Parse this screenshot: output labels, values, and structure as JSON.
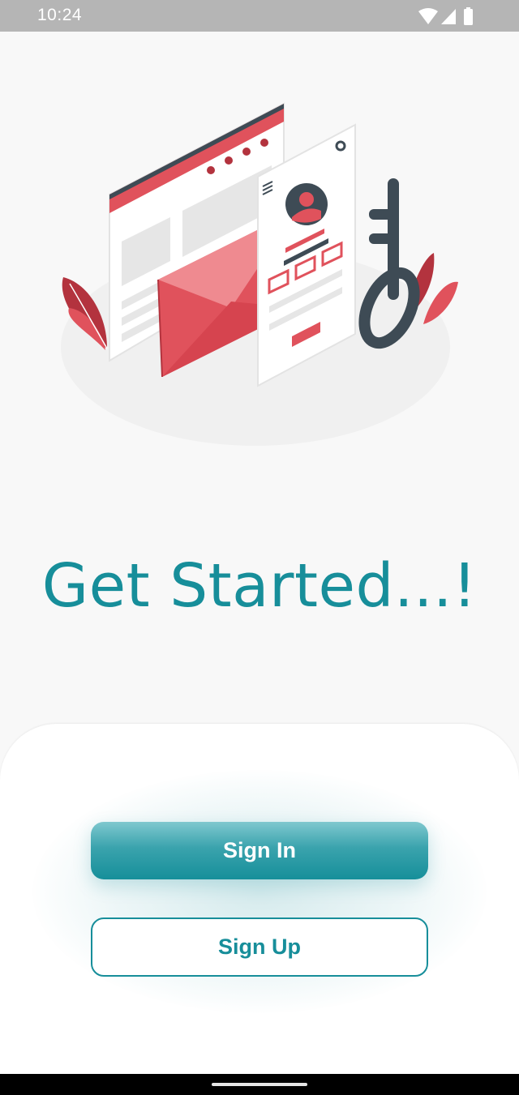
{
  "status_bar": {
    "time": "10:24",
    "icons": [
      "wifi-icon",
      "cellular-signal-icon",
      "battery-icon"
    ]
  },
  "illustration": {
    "name": "login-security-illustration",
    "colors": {
      "accent": "#e0525c",
      "dark": "#3e4b55",
      "light": "#ececec"
    }
  },
  "title": "Get Started...!",
  "buttons": {
    "sign_in": "Sign In",
    "sign_up": "Sign Up"
  },
  "theme": {
    "primary": "#178e9a",
    "background": "#f8f8f8",
    "card": "#ffffff"
  }
}
